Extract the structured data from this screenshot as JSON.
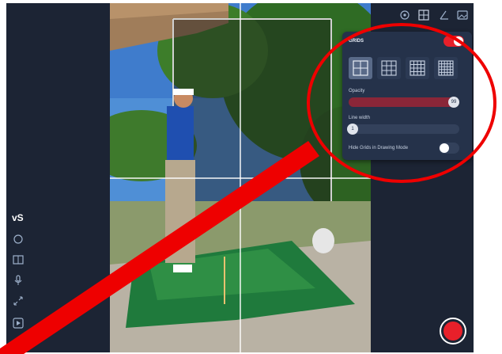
{
  "grids_panel": {
    "title": "GRIDS",
    "enabled": true,
    "grid_options": [
      "2x2 grid",
      "3x3 grid",
      "4x4 grid",
      "5x5 grid"
    ],
    "selected_option": 0,
    "opacity_label": "Opacity",
    "opacity_value": "99",
    "line_width_label": "Line width",
    "line_width_value": "1",
    "hide_in_drawing_label": "Hide Grids in Drawing Mode",
    "hide_in_drawing_enabled": false
  },
  "top_toolbar": {
    "icons": [
      "settings-icon",
      "grid-icon",
      "angle-icon",
      "image-icon"
    ]
  },
  "left_toolbar": {
    "icons": [
      "logo-icon",
      "rotate-icon",
      "split-icon",
      "mic-icon",
      "expand-icon",
      "video-icon"
    ]
  },
  "colors": {
    "accent": "#e8202a",
    "panel_bg": "#25324a",
    "app_bg": "#1c2434",
    "annotation": "#ee0000"
  }
}
